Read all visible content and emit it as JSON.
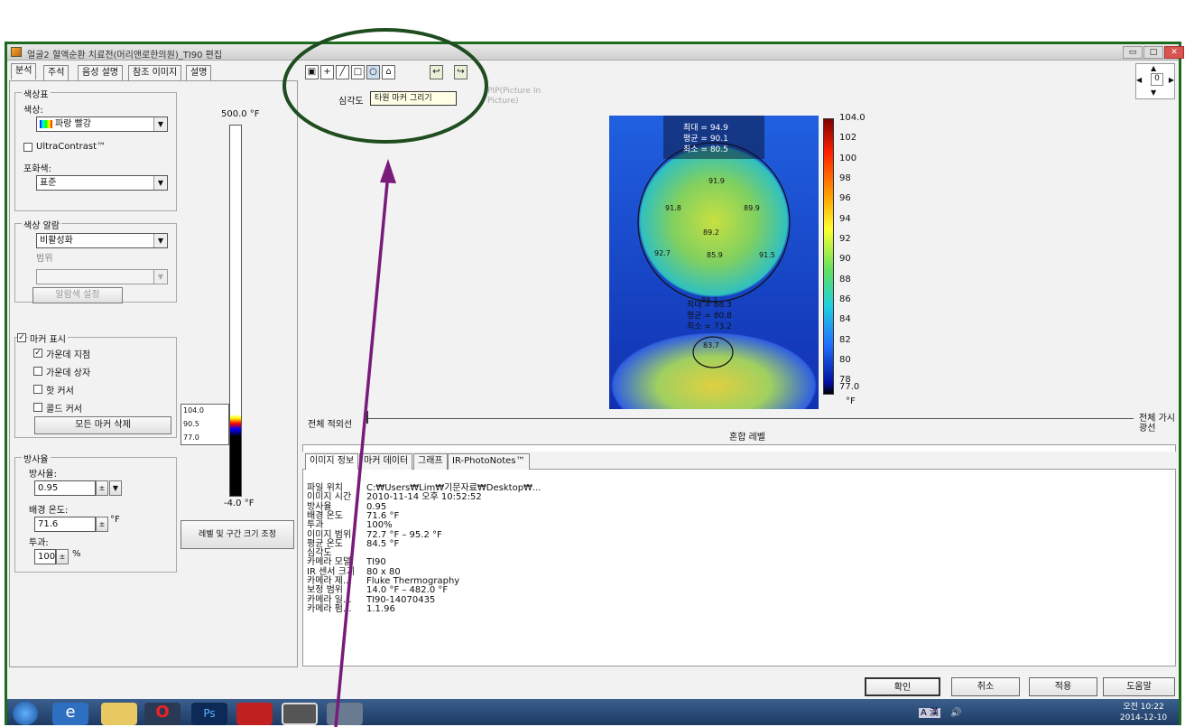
{
  "window": {
    "title": "얼굴2 혈액순환 치료전(머리앤로한의원)_TI90 편집",
    "min": "▭",
    "restore": "□",
    "close": "✕"
  },
  "tabs": [
    "분석",
    "주석",
    "음성 설명",
    "참조 이미지",
    "설명"
  ],
  "palette_group": {
    "title": "색상표",
    "color_label": "색상:",
    "color_value": "파랑 빨강",
    "ultracontrast": "UltraContrast™",
    "saturation_label": "포화색:",
    "saturation_value": "표준"
  },
  "alarm_group": {
    "title": "색상 알람",
    "mode_value": "비활성화",
    "range_label": "범위",
    "range_value": "",
    "set_button": "알람색 설정"
  },
  "marker_group": {
    "title": "마커 표시",
    "center_point": "가운데 지점",
    "center_box": "가운데 상자",
    "hot_cursor": "핫 커서",
    "cold_cursor": "콜드 커서",
    "clear_button": "모든 마커 삭제"
  },
  "emissivity_group": {
    "title": "방사율",
    "emissivity_label": "방사율:",
    "emissivity_value": "0.95",
    "bg_label": "배경 온도:",
    "bg_value": "71.6",
    "bg_unit": "°F",
    "trans_label": "투과:",
    "trans_value": "100",
    "trans_unit": "%"
  },
  "scale": {
    "top": "500.0 °F",
    "bottom": "-4.0 °F",
    "marker_values": [
      "104.0",
      "90.5",
      "77.0"
    ],
    "adjust_button": "레벨 및 구간 크기 조정"
  },
  "toolbar": {
    "tools": [
      "▣",
      "+",
      "╱",
      "□",
      "○",
      "⌂"
    ],
    "extra": [
      "↩",
      "↪"
    ],
    "isotherm_label": "심각도",
    "tooltip": "타원 마커 그리기",
    "pip_text": "PIP(Picture In Picture)"
  },
  "nav": {
    "value": "0"
  },
  "image_stats": [
    "최대 = 94.9",
    "평균 = 90.1",
    "최소 = 80.5"
  ],
  "image_points": [
    "91.9",
    "91.8",
    "89.9",
    "89.2",
    "92.7",
    "85.9",
    "91.5",
    "89.2",
    "83.7"
  ],
  "neck_stats": [
    "최대 = 88.3",
    "평균 = 80.8",
    "최소 = 73.2"
  ],
  "colorbar": {
    "ticks": [
      "104.0",
      "102",
      "100",
      "98",
      "96",
      "94",
      "92",
      "90",
      "88",
      "86",
      "84",
      "82",
      "80",
      "78",
      "77.0"
    ],
    "unit": "°F"
  },
  "blend": {
    "left": "전체 적외선",
    "center": "혼합 레벨",
    "right": "전체 가시 광선"
  },
  "info_tabs": [
    "이미지 정보",
    "마커 데이터",
    "그래프",
    "IR-PhotoNotes™"
  ],
  "info_rows": [
    [
      "파일 위치",
      "C:₩Users₩Lim₩기문자료₩Desktop₩..."
    ],
    [
      "이미지 시간",
      "2010-11-14 오후 10:52:52"
    ],
    [
      "방사율",
      "0.95"
    ],
    [
      "배경 온도",
      "71.6 °F"
    ],
    [
      "투과",
      "100%"
    ],
    [
      "이미지 범위",
      "72.7 °F – 95.2 °F"
    ],
    [
      "평균 온도",
      "84.5 °F"
    ],
    [
      "심각도",
      ""
    ],
    [
      "카메라 모델",
      "TI90"
    ],
    [
      "IR 센서 크기",
      "80 x 80"
    ],
    [
      "카메라 제...",
      "Fluke Thermography"
    ],
    [
      "보정 범위",
      "14.0 °F – 482.0 °F"
    ],
    [
      "카메라 일...",
      "TI90-14070435"
    ],
    [
      "카메라 펌...",
      "1.1.96"
    ]
  ],
  "buttons": {
    "ok": "확인",
    "cancel": "취소",
    "apply": "적용",
    "help": "도움말"
  },
  "tray": {
    "time": "오전 10:22",
    "date": "2014-12-10",
    "lang": "A 漢"
  },
  "colors": {
    "frame": "#1e6b1e",
    "annotation": "#1f4d1f",
    "arrow": "#7a1a7a"
  }
}
